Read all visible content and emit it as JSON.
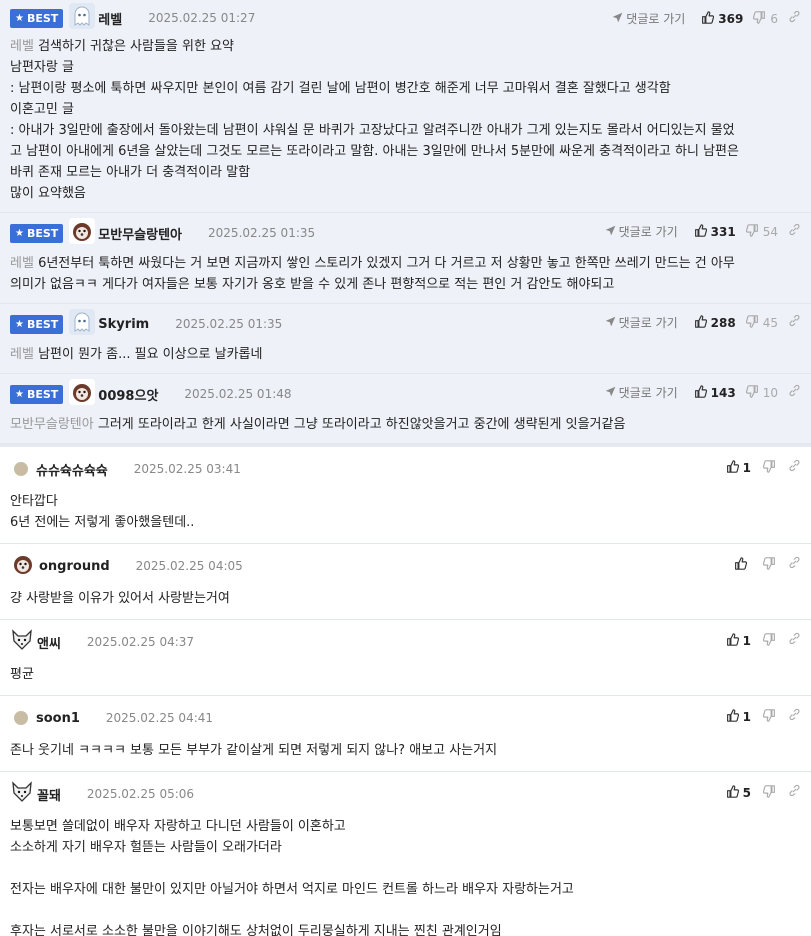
{
  "labels": {
    "best": "BEST",
    "goto": "댓글로 가기"
  },
  "best_comments": [
    {
      "nick": "레벨",
      "date": "2025.02.25 01:27",
      "up": "369",
      "down": "6",
      "mention": "레벨",
      "lines": [
        "검색하기 귀찮은 사람들을 위한 요약",
        "남편자랑 글",
        ": 남편이랑 평소에 툭하면 싸우지만 본인이 여름 감기 걸린 날에 남편이 병간호 해준게 너무 고마워서 결혼 잘했다고 생각함",
        "이혼고민 글",
        ": 아내가 3일만에 출장에서 돌아왔는데 남편이 샤워실 문 바퀴가 고장났다고 알려주니깐 아내가 그게 있는지도 몰라서 어디있는지 물었",
        "고 남편이 아내에게 6년을 살았는데 그것도 모르는 또라이라고 말함. 아내는 3일만에 만나서 5분만에 싸운게 충격적이라고 하니 남편은",
        "바퀴 존재 모르는 아내가 더 충격적이라 말함",
        "많이 요약했음"
      ]
    },
    {
      "nick": "모반무슬랑텐아",
      "date": "2025.02.25 01:35",
      "up": "331",
      "down": "54",
      "mention": "레벨",
      "lines": [
        "6년전부터 툭하면 싸웠다는 거 보면 지금까지 쌓인 스토리가 있겠지 그거 다 거르고 저 상황만 놓고 한쪽만 쓰레기 만드는 건 아무",
        "의미가 없음ㅋㅋ 게다가 여자들은 보통 자기가 옹호 받을 수 있게 존나 편향적으로 적는 편인 거 감안도 해야되고"
      ]
    },
    {
      "nick": "Skyrim",
      "date": "2025.02.25 01:35",
      "up": "288",
      "down": "45",
      "mention": "레벨",
      "lines": [
        "남편이 뭔가 좀... 필요 이상으로 날카롭네"
      ]
    },
    {
      "nick": "0098으앗",
      "date": "2025.02.25 01:48",
      "up": "143",
      "down": "10",
      "mention": "모반무슬랑텐아",
      "lines": [
        "그러게 또라이라고 한게 사실이라면 그냥 또라이라고 하진않앗을거고 중간에 생략된게 잇을거같음"
      ]
    }
  ],
  "comments": [
    {
      "nick": "슈슈슉슈슉슉",
      "date": "2025.02.25 03:41",
      "up": "1",
      "lines": [
        "안타깝다",
        "6년 전에는 저렇게 좋아했을텐데.."
      ]
    },
    {
      "nick": "onground",
      "date": "2025.02.25 04:05",
      "up": "",
      "lines": [
        "걍 사랑받을 이유가 있어서 사랑받는거여"
      ]
    },
    {
      "nick": "앤씨",
      "date": "2025.02.25 04:37",
      "up": "1",
      "lines": [
        "평균"
      ]
    },
    {
      "nick": "soon1",
      "date": "2025.02.25 04:41",
      "up": "1",
      "lines": [
        "존나 웃기네 ㅋㅋㅋㅋ 보통 모든 부부가 같이살게 되면 저렇게 되지 않나? 애보고 사는거지"
      ]
    },
    {
      "nick": "꼴돼",
      "date": "2025.02.25 05:06",
      "up": "5",
      "lines": [
        "보통보면 쓸데없이 배우자 자랑하고 다니던 사람들이 이혼하고",
        "소소하게 자기 배우자 헐뜯는 사람들이 오래가더라",
        "",
        "전자는 배우자에 대한 불만이 있지만 아닐거야 하면서 억지로 마인드 컨트롤 하느라 배우자 자랑하는거고",
        "",
        "후자는 서로서로 소소한 불만을 이야기해도 상처없이 두리뭉실하게 지내는 찐친 관계인거임"
      ]
    }
  ],
  "colors": {
    "best_bg": "#eef1f8",
    "badge": "#3a6fd8"
  },
  "icons": [
    "star-icon",
    "send-arrow-icon",
    "thumbs-up-icon",
    "thumbs-down-icon",
    "link-icon"
  ]
}
